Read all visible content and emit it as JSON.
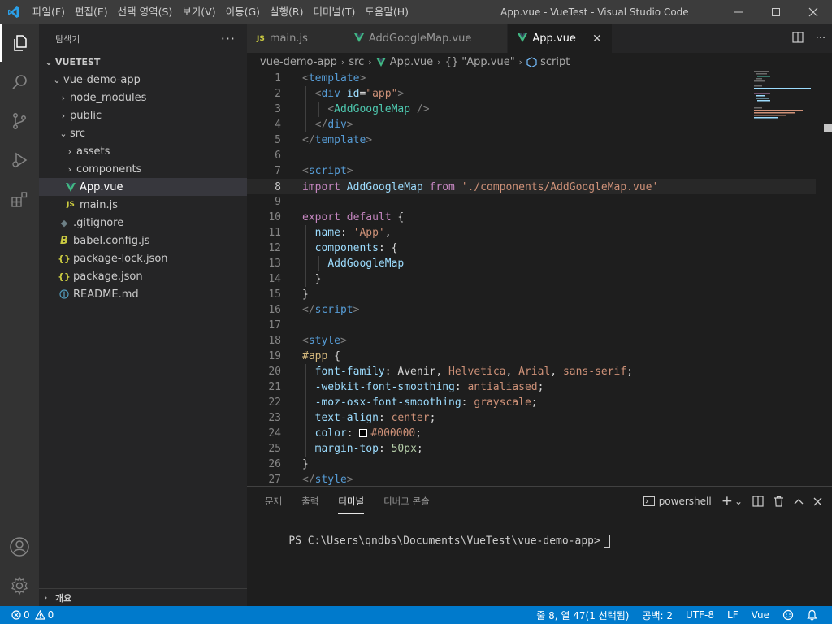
{
  "window": {
    "title": "App.vue - VueTest - Visual Studio Code",
    "menus": [
      "파일(F)",
      "편집(E)",
      "선택 영역(S)",
      "보기(V)",
      "이동(G)",
      "실행(R)",
      "터미널(T)",
      "도움말(H)"
    ]
  },
  "activity_bar": [
    "explorer-icon",
    "search-icon",
    "source-control-icon",
    "run-debug-icon",
    "extensions-icon",
    "accounts-icon",
    "settings-gear-icon"
  ],
  "sidebar": {
    "title": "탐색기",
    "more": "···",
    "root": "VUETEST",
    "items": [
      {
        "label": "vue-demo-app",
        "icon": "chevron-down"
      },
      {
        "label": "node_modules",
        "icon": "chevron-right"
      },
      {
        "label": "public",
        "icon": "chevron-right"
      },
      {
        "label": "src",
        "icon": "chevron-down"
      },
      {
        "label": "assets",
        "icon": "chevron-right"
      },
      {
        "label": "components",
        "icon": "chevron-right"
      },
      {
        "label": "App.vue",
        "icon": "vue-icon"
      },
      {
        "label": "main.js",
        "icon": "js-icon"
      },
      {
        "label": ".gitignore",
        "icon": "git-icon"
      },
      {
        "label": "babel.config.js",
        "icon": "babel-icon"
      },
      {
        "label": "package-lock.json",
        "icon": "json-icon"
      },
      {
        "label": "package.json",
        "icon": "json-icon"
      },
      {
        "label": "README.md",
        "icon": "info-icon"
      }
    ],
    "outline": "개요",
    "js_badge": "JS",
    "json_badge": "{}"
  },
  "tabs": [
    {
      "label": "main.js",
      "icon": "js-icon"
    },
    {
      "label": "AddGoogleMap.vue",
      "icon": "vue-icon"
    },
    {
      "label": "App.vue",
      "icon": "vue-icon"
    }
  ],
  "breadcrumb": {
    "parts": [
      "vue-demo-app",
      "src",
      "App.vue",
      "{} \"App.vue\"",
      "script"
    ]
  },
  "code": {
    "current_line": 8,
    "lines": [
      {
        "n": "1",
        "tokens": [
          [
            "t",
            "<"
          ],
          [
            "tn",
            "template"
          ],
          [
            "t",
            ">"
          ]
        ]
      },
      {
        "n": "2",
        "tokens": [
          [
            "pl",
            "  "
          ],
          [
            "t",
            "<"
          ],
          [
            "tn",
            "div"
          ],
          [
            "pl",
            " "
          ],
          [
            "at",
            "id"
          ],
          [
            "pl",
            "="
          ],
          [
            "st",
            "\"app\""
          ],
          [
            "t",
            ">"
          ]
        ]
      },
      {
        "n": "3",
        "tokens": [
          [
            "pl",
            "    "
          ],
          [
            "t",
            "<"
          ],
          [
            "cm",
            "AddGoogleMap"
          ],
          [
            "pl",
            " "
          ],
          [
            "t",
            "/>"
          ]
        ]
      },
      {
        "n": "4",
        "tokens": [
          [
            "pl",
            "  "
          ],
          [
            "t",
            "</"
          ],
          [
            "tn",
            "div"
          ],
          [
            "t",
            ">"
          ]
        ]
      },
      {
        "n": "5",
        "tokens": [
          [
            "t",
            "</"
          ],
          [
            "tn",
            "template"
          ],
          [
            "t",
            ">"
          ]
        ]
      },
      {
        "n": "6",
        "tokens": []
      },
      {
        "n": "7",
        "tokens": [
          [
            "t",
            "<"
          ],
          [
            "tn",
            "script"
          ],
          [
            "t",
            ">"
          ]
        ]
      },
      {
        "n": "8",
        "tokens": [
          [
            "kw",
            "import"
          ],
          [
            "pl",
            " "
          ],
          [
            "id",
            "AddGoogleMap"
          ],
          [
            "pl",
            " "
          ],
          [
            "kw",
            "from"
          ],
          [
            "pl",
            " "
          ],
          [
            "st",
            "'./components/AddGoogleMap.vue'"
          ]
        ]
      },
      {
        "n": "9",
        "tokens": []
      },
      {
        "n": "10",
        "tokens": [
          [
            "kw",
            "export"
          ],
          [
            "pl",
            " "
          ],
          [
            "kw",
            "default"
          ],
          [
            "pl",
            " {"
          ]
        ]
      },
      {
        "n": "11",
        "tokens": [
          [
            "pl",
            "  "
          ],
          [
            "id",
            "name"
          ],
          [
            "pl",
            ": "
          ],
          [
            "st",
            "'App'"
          ],
          [
            "pl",
            ","
          ]
        ]
      },
      {
        "n": "12",
        "tokens": [
          [
            "pl",
            "  "
          ],
          [
            "id",
            "components"
          ],
          [
            "pl",
            ": {"
          ]
        ]
      },
      {
        "n": "13",
        "tokens": [
          [
            "pl",
            "    "
          ],
          [
            "id",
            "AddGoogleMap"
          ]
        ]
      },
      {
        "n": "14",
        "tokens": [
          [
            "pl",
            "  }"
          ]
        ]
      },
      {
        "n": "15",
        "tokens": [
          [
            "pl",
            "}"
          ]
        ]
      },
      {
        "n": "16",
        "tokens": [
          [
            "t",
            "</"
          ],
          [
            "tn",
            "script"
          ],
          [
            "t",
            ">"
          ]
        ]
      },
      {
        "n": "17",
        "tokens": []
      },
      {
        "n": "18",
        "tokens": [
          [
            "t",
            "<"
          ],
          [
            "tn",
            "style"
          ],
          [
            "t",
            ">"
          ]
        ]
      },
      {
        "n": "19",
        "tokens": [
          [
            "sel",
            "#app"
          ],
          [
            "pl",
            " {"
          ]
        ]
      },
      {
        "n": "20",
        "tokens": [
          [
            "pl",
            "  "
          ],
          [
            "id",
            "font-family"
          ],
          [
            "pl",
            ": Avenir, "
          ],
          [
            "st",
            "Helvetica"
          ],
          [
            "pl",
            ", "
          ],
          [
            "st",
            "Arial"
          ],
          [
            "pl",
            ", "
          ],
          [
            "st",
            "sans-serif"
          ],
          [
            "pl",
            ";"
          ]
        ]
      },
      {
        "n": "21",
        "tokens": [
          [
            "pl",
            "  "
          ],
          [
            "id",
            "-webkit-font-smoothing"
          ],
          [
            "pl",
            ": "
          ],
          [
            "st",
            "antialiased"
          ],
          [
            "pl",
            ";"
          ]
        ]
      },
      {
        "n": "22",
        "tokens": [
          [
            "pl",
            "  "
          ],
          [
            "id",
            "-moz-osx-font-smoothing"
          ],
          [
            "pl",
            ": "
          ],
          [
            "st",
            "grayscale"
          ],
          [
            "pl",
            ";"
          ]
        ]
      },
      {
        "n": "23",
        "tokens": [
          [
            "pl",
            "  "
          ],
          [
            "id",
            "text-align"
          ],
          [
            "pl",
            ": "
          ],
          [
            "st",
            "center"
          ],
          [
            "pl",
            ";"
          ]
        ]
      },
      {
        "n": "24",
        "tokens": [
          [
            "pl",
            "  "
          ],
          [
            "id",
            "color"
          ],
          [
            "pl",
            ": "
          ],
          [
            "swatch",
            ""
          ],
          [
            "st",
            "#000000"
          ],
          [
            "pl",
            ";"
          ]
        ]
      },
      {
        "n": "25",
        "tokens": [
          [
            "pl",
            "  "
          ],
          [
            "id",
            "margin-top"
          ],
          [
            "pl",
            ": "
          ],
          [
            "num",
            "50px"
          ],
          [
            "pl",
            ";"
          ]
        ]
      },
      {
        "n": "26",
        "tokens": [
          [
            "pl",
            "}"
          ]
        ]
      },
      {
        "n": "27",
        "tokens": [
          [
            "t",
            "</"
          ],
          [
            "tn",
            "style"
          ],
          [
            "t",
            ">"
          ]
        ]
      }
    ]
  },
  "panel": {
    "tabs": [
      "문제",
      "출력",
      "터미널",
      "디버그 콘솔"
    ],
    "active_tab": "터미널",
    "shell": "powershell",
    "terminal_text": "PS C:\\Users\\qndbs\\Documents\\VueTest\\vue-demo-app>"
  },
  "statusbar": {
    "errors": "0",
    "warnings": "0",
    "position": "줄 8, 열 47(1 선택됨)",
    "indent": "공백: 2",
    "encoding": "UTF-8",
    "eol": "LF",
    "language": "Vue"
  },
  "colors": {
    "accent": "#007acc",
    "vue_green": "#41b883",
    "js_yellow": "#cbcb41"
  }
}
